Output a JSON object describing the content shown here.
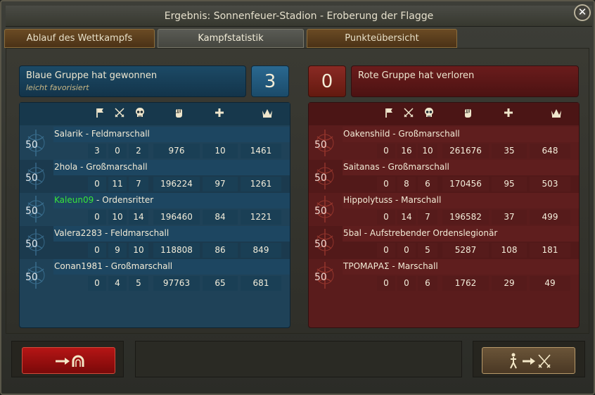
{
  "window": {
    "title": "Ergebnis: Sonnenfeuer-Stadion - Eroberung der Flagge",
    "close_label": "✕"
  },
  "tabs": [
    {
      "label": "Ablauf des Wettkampfs"
    },
    {
      "label": "Kampfstatistik"
    },
    {
      "label": "Punkteübersicht"
    }
  ],
  "summary": {
    "blue": {
      "result": "Blaue Gruppe hat gewonnen",
      "note": "leicht favorisiert",
      "score": "3"
    },
    "red": {
      "result": "Rote Gruppe hat verloren",
      "score": "0"
    }
  },
  "stat_icons": [
    "flag-icon",
    "crossed-swords-icon",
    "skull-icon",
    "fist-icon",
    "plus-icon",
    "crown-icon"
  ],
  "teams": {
    "blue": {
      "players": [
        {
          "name": "Salarik",
          "rank": "Feldmarschall",
          "level": "50",
          "stats": [
            "3",
            "0",
            "2",
            "976",
            "10",
            "1461"
          ]
        },
        {
          "name": "2hola",
          "rank": "Großmarschall",
          "level": "50",
          "stats": [
            "0",
            "11",
            "7",
            "196224",
            "97",
            "1261"
          ]
        },
        {
          "name": "Kaleun09",
          "rank": "Ordensritter",
          "level": "50",
          "stats": [
            "0",
            "10",
            "14",
            "196460",
            "84",
            "1221"
          ],
          "is_self": true
        },
        {
          "name": "Valera2283",
          "rank": "Feldmarschall",
          "level": "50",
          "stats": [
            "0",
            "9",
            "10",
            "118808",
            "86",
            "849"
          ]
        },
        {
          "name": "Conan1981",
          "rank": "Großmarschall",
          "level": "50",
          "stats": [
            "0",
            "4",
            "5",
            "97763",
            "65",
            "681"
          ]
        }
      ]
    },
    "red": {
      "players": [
        {
          "name": "Oakenshild",
          "rank": "Großmarschall",
          "level": "50",
          "stats": [
            "0",
            "16",
            "10",
            "261676",
            "35",
            "648"
          ]
        },
        {
          "name": "Saitanas",
          "rank": "Großmarschall",
          "level": "50",
          "stats": [
            "0",
            "8",
            "6",
            "170456",
            "95",
            "503"
          ]
        },
        {
          "name": "Hippolytuss",
          "rank": "Marschall",
          "level": "50",
          "stats": [
            "0",
            "14",
            "7",
            "196582",
            "37",
            "499"
          ]
        },
        {
          "name": "5bal",
          "rank": "Aufstrebender Ordenslegionär",
          "level": "50",
          "stats": [
            "0",
            "0",
            "5",
            "5287",
            "108",
            "181"
          ]
        },
        {
          "name": "ΤΡΟΜΑΡΑΣ",
          "rank": "Marschall",
          "level": "50",
          "stats": [
            "0",
            "0",
            "6",
            "1762",
            "29",
            "49"
          ]
        }
      ]
    }
  },
  "buttons": {
    "exit_icon": "arrow-to-gate-icon",
    "join_icon": "walker-arrow-swords-icon"
  },
  "colors": {
    "blue_team": "#1f4258",
    "red_team": "#5a1c1c",
    "self_name": "#38e43a",
    "exit_button": "#b51515"
  }
}
